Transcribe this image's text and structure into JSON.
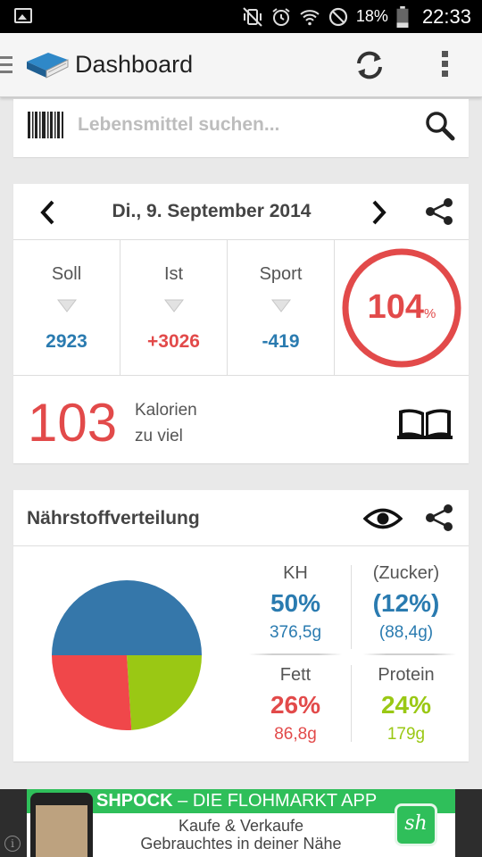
{
  "status_bar": {
    "battery": "18%",
    "time": "22:33"
  },
  "action_bar": {
    "title": "Dashboard"
  },
  "search": {
    "placeholder": "Lebensmittel suchen..."
  },
  "calories": {
    "date": "Di., 9. September 2014",
    "stats": [
      {
        "label": "Soll",
        "value": "2923",
        "color": "#2a7bb0"
      },
      {
        "label": "Ist",
        "value": "+3026",
        "color": "#e24a4a"
      },
      {
        "label": "Sport",
        "value": "-419",
        "color": "#2a7bb0"
      }
    ],
    "percent": "104",
    "percent_sign": "%",
    "percent_fraction": 1.04,
    "difference": "103",
    "difference_label_line1": "Kalorien",
    "difference_label_line2": "zu viel"
  },
  "nutrients": {
    "title": "Nährstoffverteilung",
    "kh": {
      "label": "KH",
      "percent": "50%",
      "grams": "376,5g",
      "color": "#2a7bb0"
    },
    "zucker": {
      "label": "(Zucker)",
      "percent": "(12%)",
      "grams": "(88,4g)",
      "color": "#2a7bb0"
    },
    "fett": {
      "label": "Fett",
      "percent": "26%",
      "grams": "86,8g",
      "color": "#e24a4a"
    },
    "protein": {
      "label": "Protein",
      "percent": "24%",
      "grams": "179g",
      "color": "#9ac814"
    },
    "pie_slices": [
      {
        "name": "KH",
        "value": 50,
        "color": "#3577aa"
      },
      {
        "name": "Fett",
        "value": 26,
        "color": "#f0474a"
      },
      {
        "name": "Protein",
        "value": 24,
        "color": "#9ac814"
      }
    ]
  },
  "ad": {
    "headline_brand": "SHPOCK",
    "headline_rest": " – DIE FLOHMARKT APP",
    "line1": "Kaufe & Verkaufe",
    "line2": "Gebrauchtes in deiner Nähe",
    "logo": "sh",
    "info": "i"
  }
}
